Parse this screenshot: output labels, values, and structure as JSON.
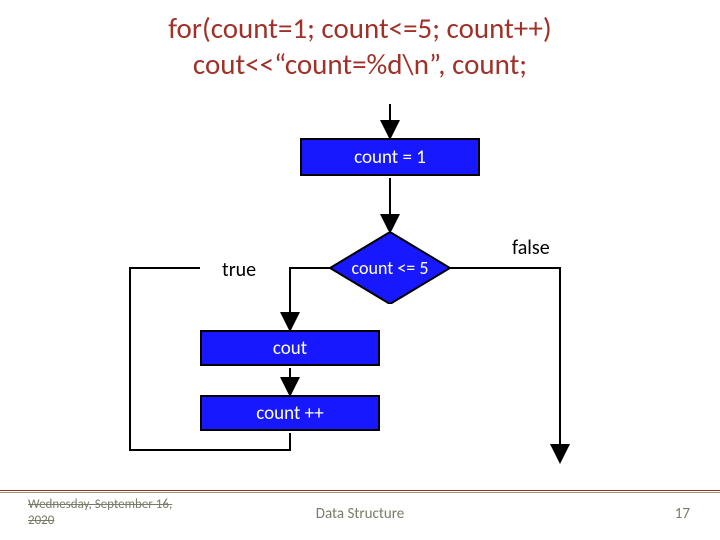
{
  "title": {
    "line1": "for(count=1; count<=5; count++)",
    "line2": "cout<<“count=%d\\n”, count;"
  },
  "nodes": {
    "init": "count = 1",
    "cond": "count <= 5",
    "body": "cout",
    "incr": "count ++"
  },
  "labels": {
    "true": "true",
    "false": "false"
  },
  "footer": {
    "date": "Wednesday, September 16, 2020",
    "center": "Data Structure",
    "page": "17"
  },
  "chart_data": {
    "type": "flowchart",
    "title": "for-loop execution flow",
    "nodes": [
      {
        "id": "init",
        "shape": "rect",
        "text": "count = 1"
      },
      {
        "id": "cond",
        "shape": "diamond",
        "text": "count <= 5"
      },
      {
        "id": "body",
        "shape": "rect",
        "text": "cout"
      },
      {
        "id": "incr",
        "shape": "rect",
        "text": "count ++"
      },
      {
        "id": "exit",
        "shape": "point",
        "text": ""
      }
    ],
    "edges": [
      {
        "from": "start",
        "to": "init"
      },
      {
        "from": "init",
        "to": "cond"
      },
      {
        "from": "cond",
        "to": "body",
        "label": "true"
      },
      {
        "from": "body",
        "to": "incr"
      },
      {
        "from": "incr",
        "to": "cond"
      },
      {
        "from": "cond",
        "to": "exit",
        "label": "false"
      }
    ],
    "colors": {
      "node_fill": "#1818ff",
      "node_text": "#ffffff",
      "edge": "#000000"
    }
  }
}
